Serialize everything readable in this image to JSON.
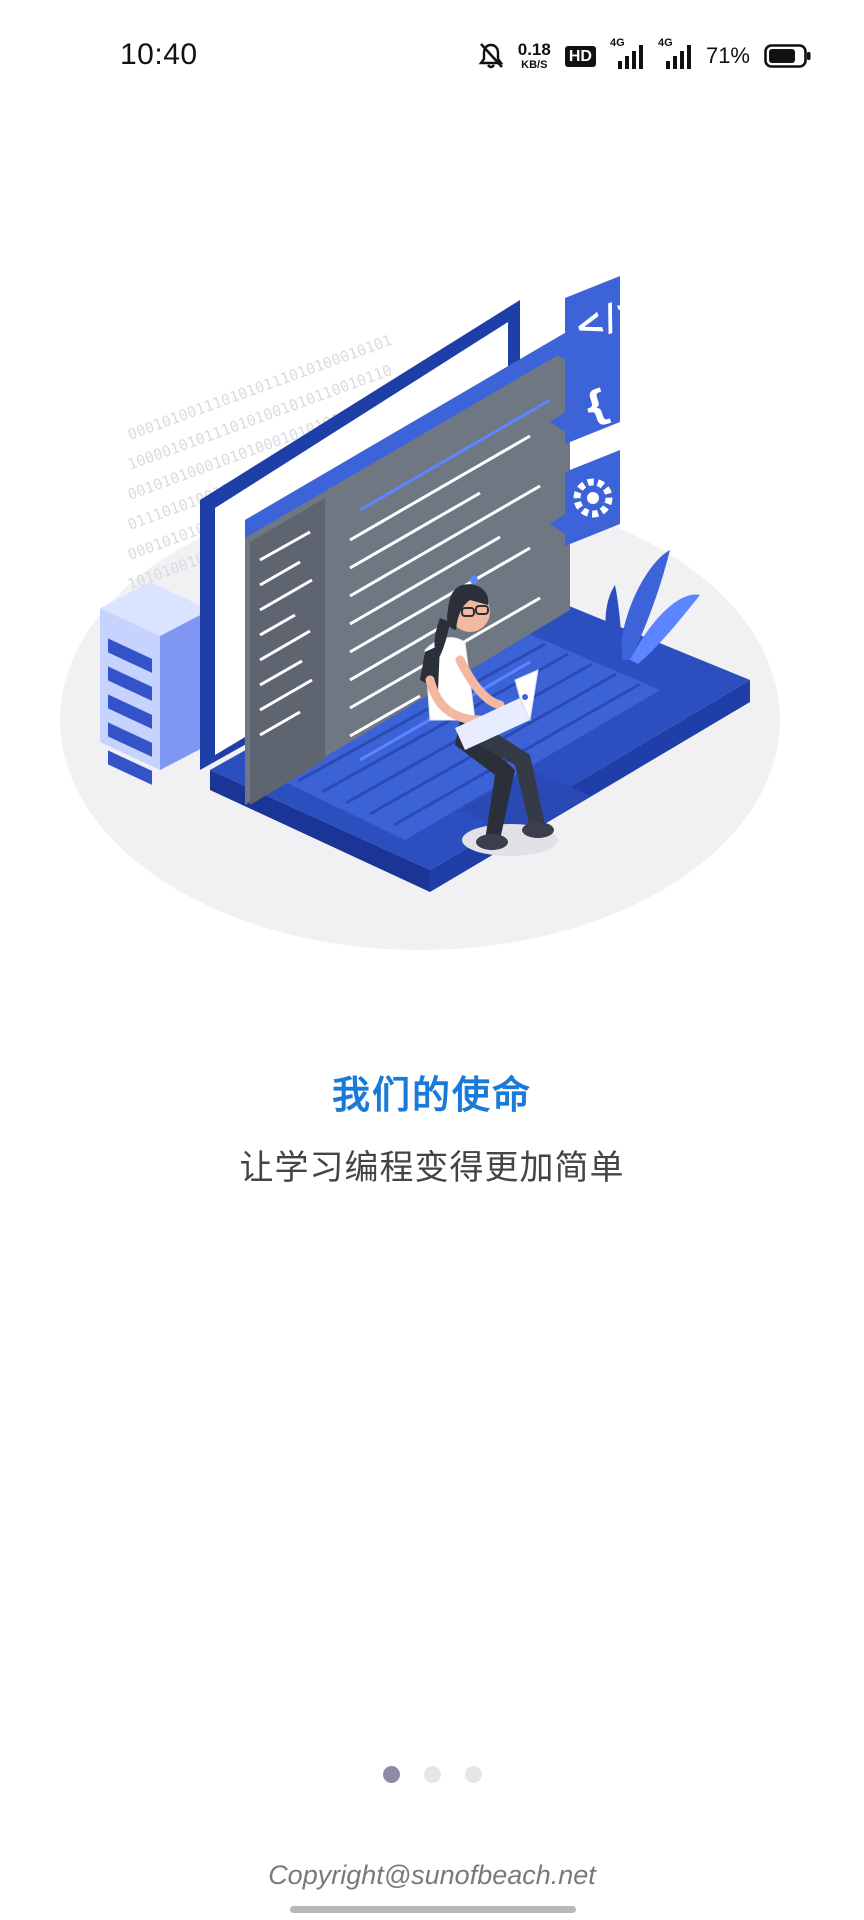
{
  "status_bar": {
    "time": "10:40",
    "net_speed_value": "0.18",
    "net_speed_unit": "KB/S",
    "hd_label": "HD",
    "sim1_tag": "4G",
    "sim2_tag": "4G",
    "battery_percent": "71%",
    "icons": [
      "bell-muted-icon",
      "hd-icon",
      "signal-4g-icon",
      "signal-4g-icon",
      "battery-icon"
    ]
  },
  "onboarding": {
    "illustration": "developer-laptop-illustration",
    "title": "我们的使命",
    "subtitle": "让学习编程变得更加简单",
    "page_count": 3,
    "active_page": 1
  },
  "footer": {
    "copyright": "Copyright@sunofbeach.net"
  },
  "colors": {
    "accent": "#1a7ad8",
    "subtitle": "#444444",
    "illustration_blue": "#2c4fbf",
    "dot_active": "#8b8ba8",
    "dot_inactive": "#e6e6ea"
  }
}
